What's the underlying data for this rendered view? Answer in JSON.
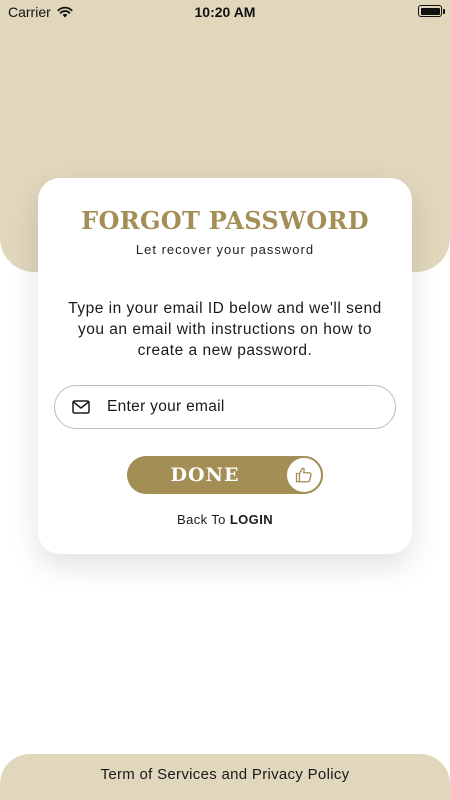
{
  "status_bar": {
    "carrier": "Carrier",
    "time": "10:20 AM"
  },
  "card": {
    "title": "FORGOT PASSWORD",
    "subtitle": "Let recover your password",
    "instructions": "Type in your email ID below and we'll send you an email with instructions on how to create a new password.",
    "email_placeholder": "Enter your email",
    "email_icon": "mail-icon",
    "done_label": "DONE",
    "done_icon": "thumbs-up-icon",
    "back_prefix": "Back To",
    "back_link": "LOGIN"
  },
  "footer": {
    "link": "Term of Services and Privacy Policy"
  },
  "colors": {
    "accent": "#a38f55",
    "header_bg": "#e0d7bd",
    "card_bg": "#ffffff"
  }
}
